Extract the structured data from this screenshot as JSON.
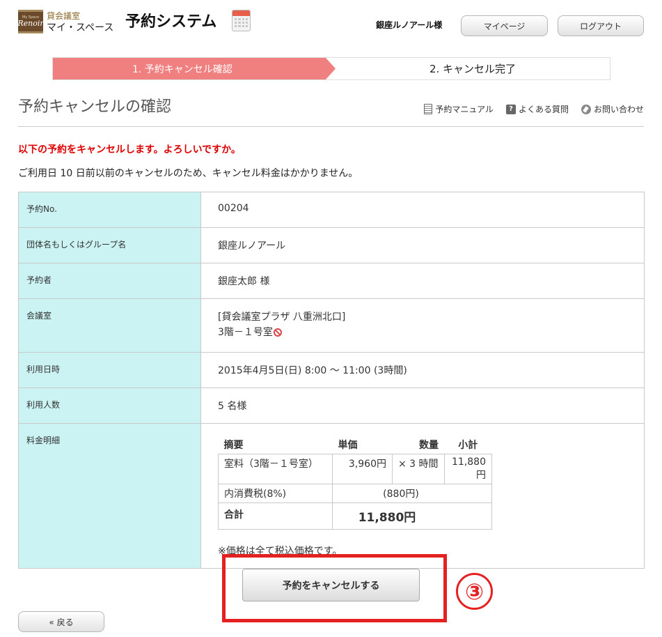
{
  "header": {
    "logo_small": "My Space",
    "logo_script": "Renoir",
    "brand_line1": "貸会議室",
    "brand_line2": "マイ・スペース",
    "system_title": "予約システム",
    "user_name": "銀座ルノアール様",
    "mypage_label": "マイページ",
    "logout_label": "ログアウト"
  },
  "steps": {
    "step1": "1. 予約キャンセル確認",
    "step2": "2. キャンセル完了"
  },
  "page": {
    "title": "予約キャンセルの確認",
    "links": {
      "manual": "予約マニュアル",
      "faq": "よくある質問",
      "contact": "お問い合わせ"
    },
    "warning": "以下の予約をキャンセルします。よろしいですか。",
    "note": "ご利用日 10 日前以前のキャンセルのため、キャンセル料金はかかりません。"
  },
  "details": {
    "reservation_no": {
      "label": "予約No.",
      "value": "00204"
    },
    "group": {
      "label": "団体名もしくはグループ名",
      "value": "銀座ルノアール"
    },
    "booker": {
      "label": "予約者",
      "value": "銀座太郎 様"
    },
    "room": {
      "label": "会議室",
      "value_line1": "[貸会議室プラザ 八重洲北口]",
      "value_line2": "3階－１号室"
    },
    "datetime": {
      "label": "利用日時",
      "value": "2015年4月5日(日) 8:00 ～ 11:00 (3時間)"
    },
    "people": {
      "label": "利用人数",
      "value": "5 名様"
    },
    "fees": {
      "label": "料金明細",
      "headers": {
        "summary": "摘要",
        "unit": "単価",
        "qty": "数量",
        "subtotal": "小計"
      },
      "room_row": {
        "summary": "室料（3階－１号室）",
        "unit": "3,960円",
        "qty": "× 3 時間",
        "subtotal": "11,880円"
      },
      "tax_row": {
        "summary": "内消費税(8%)",
        "amount": "(880円)"
      },
      "total_row": {
        "label": "合計",
        "amount": "11,880円"
      },
      "note": "※価格は全て税込価格です。"
    }
  },
  "actions": {
    "cancel_label": "予約をキャンセルする",
    "step_marker": "③",
    "back_label": "« 戻る"
  },
  "colors": {
    "step_active": "#f08080",
    "label_cell": "#ccf3f3",
    "warning": "#e00000",
    "highlight": "#e52020"
  }
}
